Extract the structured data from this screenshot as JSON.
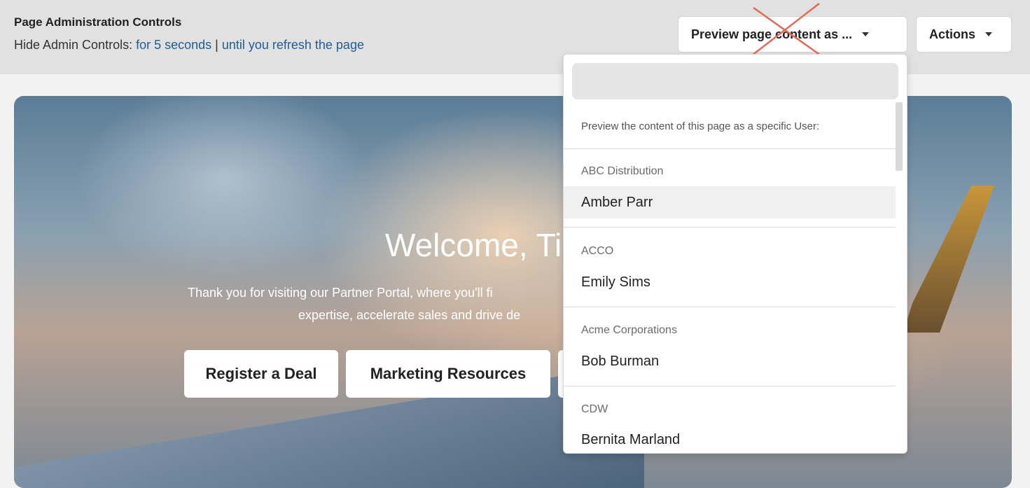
{
  "admin": {
    "title": "Page Administration Controls",
    "hide_prefix": "Hide Admin Controls: ",
    "hide_5s": "for 5 seconds",
    "separator": " | ",
    "hide_refresh": "until you refresh the page"
  },
  "toolbar": {
    "preview_label": "Preview page content as ...",
    "actions_label": "Actions"
  },
  "hero": {
    "welcome": "Welcome, Ti",
    "line1": "Thank you for visiting our Partner Portal, where you'll fi",
    "line2": "expertise, accelerate sales and drive de",
    "buttons": [
      "Register a Deal",
      "Marketing Resources"
    ]
  },
  "dropdown": {
    "search_value": "",
    "help_text": "Preview the content of this page as a specific User:",
    "groups": [
      {
        "name": "ABC Distribution",
        "user": "Amber Parr"
      },
      {
        "name": "ACCO",
        "user": "Emily Sims"
      },
      {
        "name": "Acme Corporations",
        "user": "Bob Burman"
      },
      {
        "name": "CDW",
        "user": "Bernita Marland"
      }
    ]
  },
  "colors": {
    "link": "#1f5d96",
    "admin_bar": "#e1e1e1",
    "cross": "#e06a5a"
  }
}
